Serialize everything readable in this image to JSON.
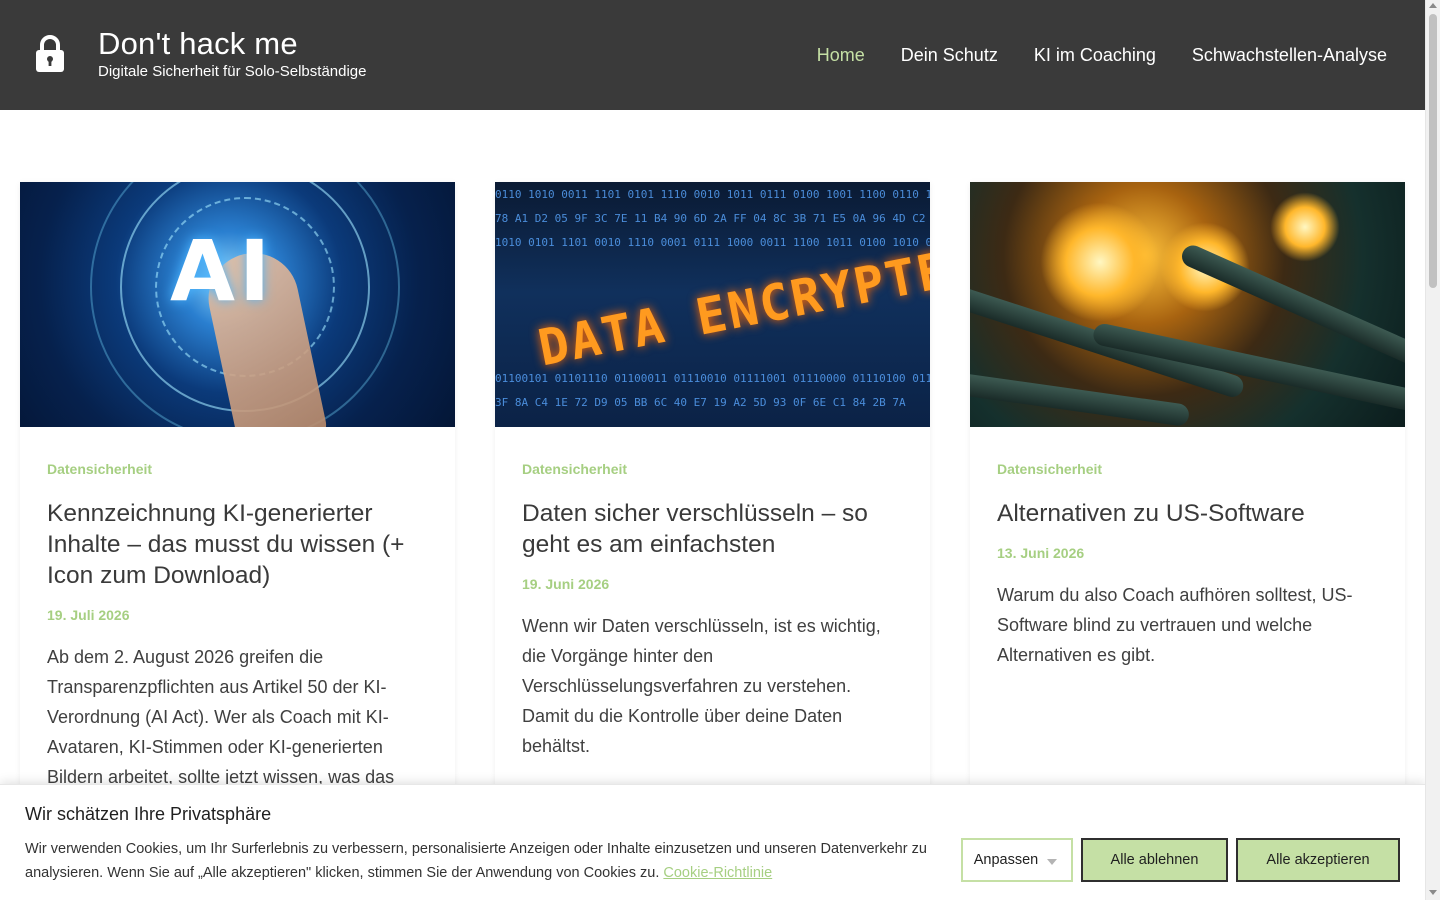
{
  "header": {
    "site_title": "Don't hack me",
    "tagline": "Digitale Sicherheit für Solo-Selbständige",
    "nav": [
      {
        "label": "Home",
        "active": true
      },
      {
        "label": "Dein Schutz",
        "active": false
      },
      {
        "label": "KI im Coaching",
        "active": false
      },
      {
        "label": "Schwachstellen-Analyse",
        "active": false
      }
    ]
  },
  "posts": [
    {
      "category": "Datensicherheit",
      "title": "Kennzeichnung KI-generierter Inhalte – das musst du wissen (+ Icon zum Download)",
      "date": "19. Juli 2026",
      "excerpt": "Ab dem 2. August 2026 greifen die Transparenzpflichten aus Artikel 50 der KI-Verordnung (AI Act). Wer als Coach mit KI-Avataren, KI-Stimmen oder KI-generierten Bildern arbeitet, sollte jetzt wissen, was das",
      "image_text": "AI"
    },
    {
      "category": "Datensicherheit",
      "title": "Daten sicher verschlüsseln – so geht es am einfachsten",
      "date": "19. Juni 2026",
      "excerpt": "Wenn wir Daten verschlüsseln, ist es wichtig, die Vorgänge hinter den Verschlüsselungsverfahren zu verstehen. Damit du die Kontrolle über deine Daten behältst.",
      "image_text": "DATA ENCRYPTED"
    },
    {
      "category": "Datensicherheit",
      "title": "Alternativen zu US-Software",
      "date": "13. Juni 2026",
      "excerpt": "Warum du also Coach aufhören solltest, US-Software blind zu vertrauen und welche Alternativen es gibt."
    }
  ],
  "cookie_banner": {
    "title": "Wir schätzen Ihre Privatsphäre",
    "text": "Wir verwenden Cookies, um Ihr Surferlebnis zu verbessern, personalisierte Anzeigen oder Inhalte einzusetzen und unseren Datenverkehr zu analysieren. Wenn Sie auf „Alle akzeptieren\" klicken, stimmen Sie der Anwendung von Cookies zu.",
    "link_label": "Cookie-Richtlinie",
    "customize_label": "Anpassen",
    "reject_label": "Alle ablehnen",
    "accept_label": "Alle akzeptieren"
  },
  "colors": {
    "header_bg": "#3a3a3a",
    "accent_green": "#a6cf82",
    "button_green": "#c5e0a5",
    "nav_active": "#c5e0a5"
  }
}
